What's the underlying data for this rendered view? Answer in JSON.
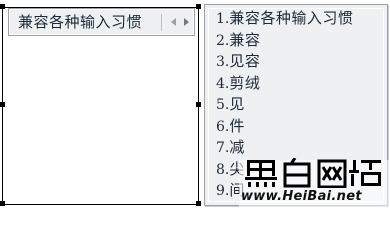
{
  "composition": {
    "text": "兼容各种输入习惯",
    "prev_icon": "triangle-left-icon",
    "next_icon": "triangle-right-icon"
  },
  "candidates": [
    {
      "num": "1.",
      "text": "兼容各种输入习惯"
    },
    {
      "num": "2.",
      "text": "兼容"
    },
    {
      "num": "3.",
      "text": "见容"
    },
    {
      "num": "4.",
      "text": "剪绒"
    },
    {
      "num": "5.",
      "text": "见"
    },
    {
      "num": "6.",
      "text": "件"
    },
    {
      "num": "7.",
      "text": "减"
    },
    {
      "num": "8.",
      "text": "尖"
    },
    {
      "num": "9.",
      "text": "间"
    }
  ],
  "watermark": {
    "logo_text": "黑白网络",
    "url": "www.HeiBai.net"
  },
  "colors": {
    "panel_bg": "#eef0f2",
    "panel_border": "#9aa3ad",
    "text": "#1b2a3a"
  }
}
